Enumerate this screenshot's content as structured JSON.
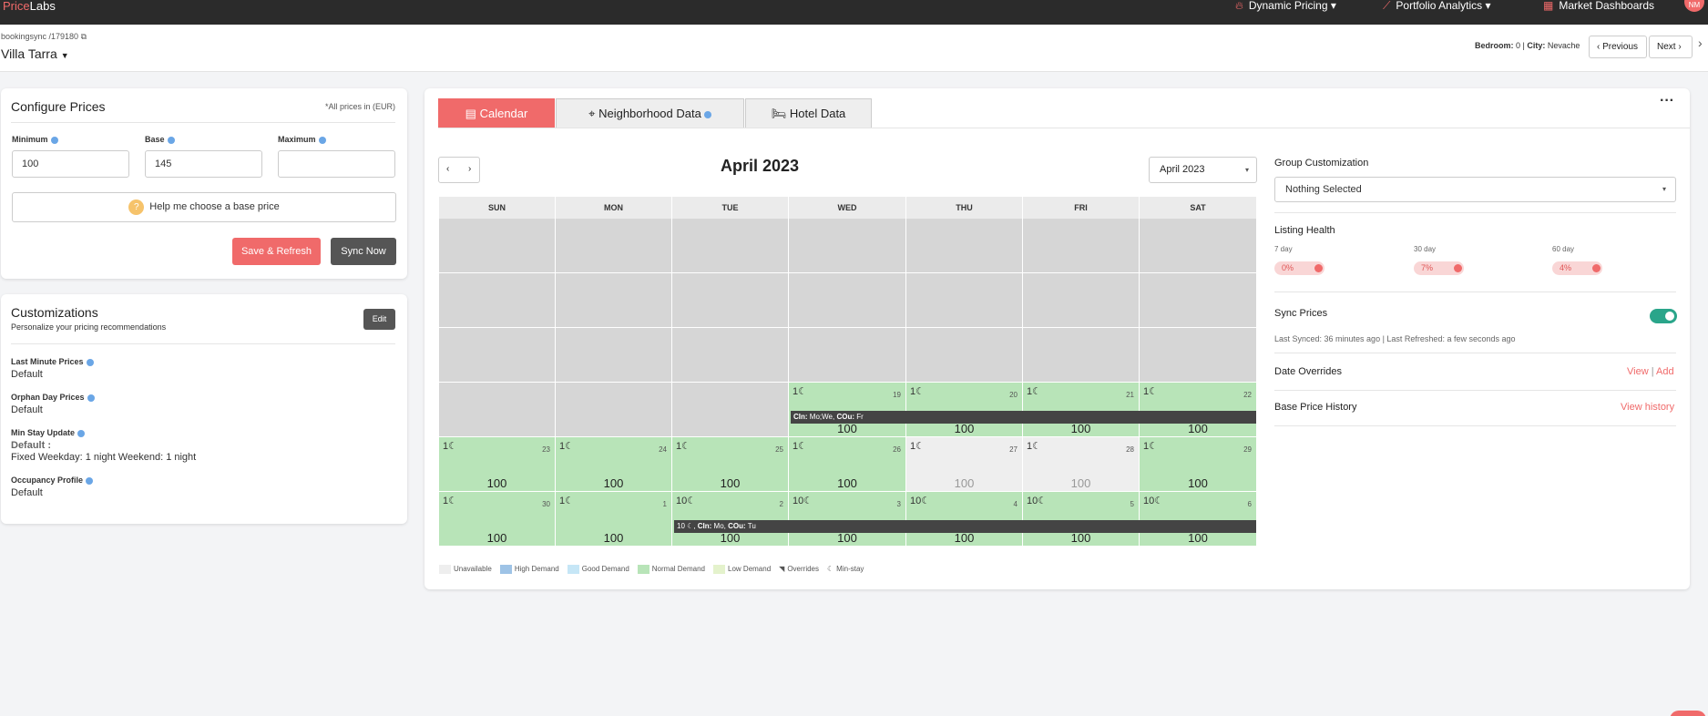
{
  "brand": {
    "part1": "Price",
    "part2": "Labs"
  },
  "nav": {
    "dynamic_pricing": "Dynamic Pricing",
    "portfolio_analytics": "Portfolio Analytics",
    "market_dashboards": "Market Dashboards",
    "avatar_initials": "NM"
  },
  "header": {
    "breadcrumb": "bookingsync /179180",
    "property_name": "Villa Tarra",
    "bedroom_label": "Bedroom:",
    "bedroom_value": "0",
    "city_label": "City:",
    "city_value": "Nevache",
    "prev_label": "Previous",
    "next_label": "Next"
  },
  "configure": {
    "title": "Configure Prices",
    "currency_note": "*All prices in (EUR)",
    "min_label": "Minimum",
    "base_label": "Base",
    "max_label": "Maximum",
    "min_value": "100",
    "base_value": "145",
    "max_value": "",
    "help_label": "Help me choose a base price",
    "save_label": "Save & Refresh",
    "sync_label": "Sync Now"
  },
  "customizations": {
    "title": "Customizations",
    "subtitle": "Personalize your pricing recommendations",
    "edit_label": "Edit",
    "items": [
      {
        "label": "Last Minute Prices",
        "value": "Default"
      },
      {
        "label": "Orphan Day Prices",
        "value": "Default"
      },
      {
        "label": "Min Stay Update",
        "value": "Default :",
        "detail": "Fixed Weekday: 1 night Weekend: 1 night"
      },
      {
        "label": "Occupancy Profile",
        "value": "Default"
      }
    ]
  },
  "tabs": {
    "calendar": "Calendar",
    "neighborhood": "Neighborhood Data",
    "hotel": "Hotel Data",
    "more": "···"
  },
  "calendar": {
    "title": "April 2023",
    "month_select": "April 2023",
    "weekdays": [
      "SUN",
      "MON",
      "TUE",
      "WED",
      "THU",
      "FRI",
      "SAT"
    ],
    "rows": [
      [
        {
          "s": "na"
        },
        {
          "s": "na"
        },
        {
          "s": "na"
        },
        {
          "s": "na"
        },
        {
          "s": "na"
        },
        {
          "s": "na"
        },
        {
          "s": "na"
        }
      ],
      [
        {
          "s": "na"
        },
        {
          "s": "na"
        },
        {
          "s": "na"
        },
        {
          "s": "na"
        },
        {
          "s": "na"
        },
        {
          "s": "na"
        },
        {
          "s": "na"
        }
      ],
      [
        {
          "s": "na"
        },
        {
          "s": "na"
        },
        {
          "s": "na"
        },
        {
          "s": "na"
        },
        {
          "s": "na"
        },
        {
          "s": "na"
        },
        {
          "s": "na"
        }
      ],
      [
        {
          "s": "na"
        },
        {
          "s": "na"
        },
        {
          "s": "na"
        },
        {
          "s": "normal",
          "d": "19",
          "p": "100",
          "m": "1☾"
        },
        {
          "s": "normal",
          "d": "20",
          "p": "100",
          "m": "1☾"
        },
        {
          "s": "normal",
          "d": "21",
          "p": "100",
          "m": "1☾"
        },
        {
          "s": "normal",
          "d": "22",
          "p": "100",
          "m": "1☾"
        }
      ],
      [
        {
          "s": "normal",
          "d": "23",
          "p": "100",
          "m": "1☾"
        },
        {
          "s": "normal",
          "d": "24",
          "p": "100",
          "m": "1☾"
        },
        {
          "s": "normal",
          "d": "25",
          "p": "100",
          "m": "1☾"
        },
        {
          "s": "normal",
          "d": "26",
          "p": "100",
          "m": "1☾"
        },
        {
          "s": "unavail",
          "d": "27",
          "p": "100",
          "m": "1☾"
        },
        {
          "s": "unavail",
          "d": "28",
          "p": "100",
          "m": "1☾"
        },
        {
          "s": "normal",
          "d": "29",
          "p": "100",
          "m": "1☾"
        }
      ],
      [
        {
          "s": "normal",
          "d": "30",
          "p": "100",
          "m": "1☾"
        },
        {
          "s": "normal",
          "d": "1",
          "p": "100",
          "m": "1☾"
        },
        {
          "s": "normal",
          "d": "2",
          "p": "100",
          "m": "10☾"
        },
        {
          "s": "normal",
          "d": "3",
          "p": "100",
          "m": "10☾"
        },
        {
          "s": "normal",
          "d": "4",
          "p": "100",
          "m": "10☾"
        },
        {
          "s": "normal",
          "d": "5",
          "p": "100",
          "m": "10☾"
        },
        {
          "s": "normal",
          "d": "6",
          "p": "100",
          "m": "10☾"
        }
      ]
    ],
    "band1": {
      "prefix": "CIn:",
      "cin": "Mo;We,",
      "cout_label": "COu:",
      "cout": "Fr"
    },
    "band2": {
      "prefix": "10 ☾,",
      "cin_label": "CIn:",
      "cin": "Mo,",
      "cout_label": "COu:",
      "cout": "Tu"
    },
    "legend": [
      {
        "label": "Unavailable",
        "color": "#eeeeee"
      },
      {
        "label": "High Demand",
        "color": "#9ec3e6"
      },
      {
        "label": "Good Demand",
        "color": "#c6e6f6"
      },
      {
        "label": "Normal Demand",
        "color": "#b8e4b8"
      },
      {
        "label": "Low Demand",
        "color": "#e4f2cc"
      },
      {
        "label": "Overrides",
        "icon": "◥"
      },
      {
        "label": "Min-stay",
        "icon": "☾"
      }
    ]
  },
  "right_panel": {
    "group_label": "Group Customization",
    "group_value": "Nothing Selected",
    "health_label": "Listing Health",
    "health": [
      {
        "period": "7 day",
        "value": "0%"
      },
      {
        "period": "30 day",
        "value": "7%"
      },
      {
        "period": "60 day",
        "value": "4%"
      }
    ],
    "sync_label": "Sync Prices",
    "sync_on": true,
    "last_synced": "Last Synced: 36 minutes ago | Last Refreshed: a few seconds ago",
    "date_overrides": "Date Overrides",
    "view": "View",
    "sep": "|",
    "add": "Add",
    "base_history": "Base Price History",
    "view_history": "View history"
  },
  "colors": {
    "accent": "#f06a6a",
    "normal_demand": "#b8e4b8",
    "toggle_on": "#2aa58a"
  }
}
